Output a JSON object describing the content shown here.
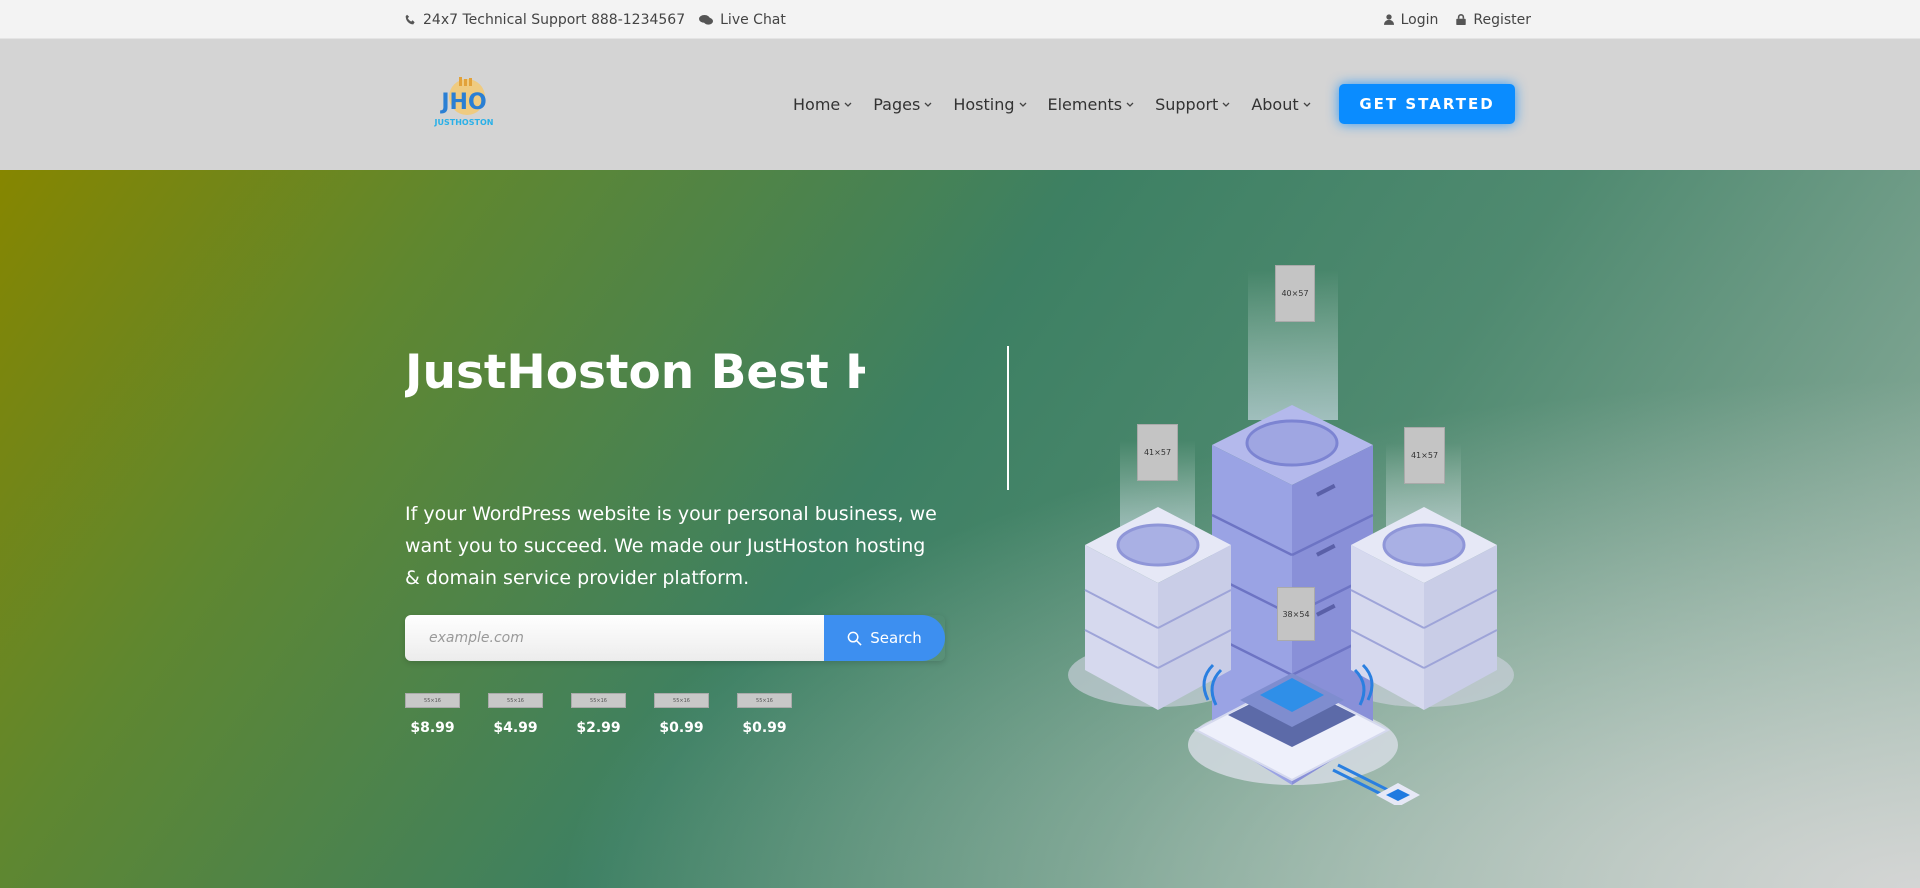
{
  "topbar": {
    "support": "24x7 Technical Support 888-1234567",
    "live_chat": "Live Chat",
    "login": "Login",
    "register": "Register"
  },
  "header": {
    "logo_text": "JUSTHOSTON",
    "logo_mark": "JHO",
    "nav": [
      {
        "label": "Home"
      },
      {
        "label": "Pages"
      },
      {
        "label": "Hosting"
      },
      {
        "label": "Elements"
      },
      {
        "label": "Support"
      },
      {
        "label": "About"
      }
    ],
    "cta": "GET STARTED"
  },
  "hero": {
    "title": "JustHoston Best Ho",
    "description": "If your WordPress website is your personal business, we want you to succeed. We made our JustHoston hosting & domain service provider platform.",
    "search_placeholder": "example.com",
    "search_button": "Search",
    "tlds": [
      {
        "image_label": "55×16",
        "price": "$8.99"
      },
      {
        "image_label": "55×16",
        "price": "$4.99"
      },
      {
        "image_label": "55×16",
        "price": "$2.99"
      },
      {
        "image_label": "55×16",
        "price": "$0.99"
      },
      {
        "image_label": "55×16",
        "price": "$0.99"
      }
    ],
    "illustration_placeholders": [
      "40×57",
      "41×57",
      "41×57",
      "38×54"
    ]
  },
  "colors": {
    "cta_blue": "#0a8cff",
    "search_blue": "#3d8ff0",
    "header_bg": "#d4d4d4",
    "topbar_bg": "#f3f3f3"
  }
}
